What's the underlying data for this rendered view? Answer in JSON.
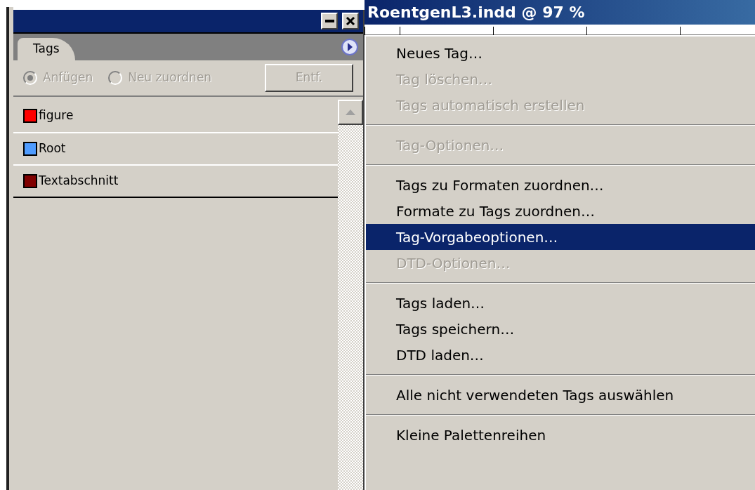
{
  "document_window": {
    "title": "RoentgenL3.indd @ 97 %"
  },
  "panel": {
    "tabs": [
      {
        "label": "Tags",
        "selected": true
      }
    ],
    "options": [
      {
        "label": "Anfügen",
        "selected": true,
        "disabled": true
      },
      {
        "label": "Neu zuordnen",
        "selected": false,
        "disabled": true
      }
    ],
    "delete_button": {
      "label": "Entf.",
      "disabled": true
    },
    "tags": [
      {
        "name": "figure",
        "color": "#ff0000"
      },
      {
        "name": "Root",
        "color": "#4f9cff"
      },
      {
        "name": "Textabschnitt",
        "color": "#800000"
      }
    ]
  },
  "menu": [
    {
      "kind": "item",
      "label": "Neues Tag…",
      "disabled": false,
      "selected": false
    },
    {
      "kind": "item",
      "label": "Tag löschen…",
      "disabled": true,
      "selected": false
    },
    {
      "kind": "item",
      "label": "Tags automatisch erstellen",
      "disabled": true,
      "selected": false
    },
    {
      "kind": "separator"
    },
    {
      "kind": "item",
      "label": "Tag-Optionen…",
      "disabled": true,
      "selected": false
    },
    {
      "kind": "separator"
    },
    {
      "kind": "item",
      "label": "Tags zu Formaten zuordnen…",
      "disabled": false,
      "selected": false
    },
    {
      "kind": "item",
      "label": "Formate zu Tags zuordnen…",
      "disabled": false,
      "selected": false
    },
    {
      "kind": "item",
      "label": "Tag-Vorgabeoptionen…",
      "disabled": false,
      "selected": true
    },
    {
      "kind": "item",
      "label": "DTD-Optionen…",
      "disabled": true,
      "selected": false
    },
    {
      "kind": "separator"
    },
    {
      "kind": "item",
      "label": "Tags laden…",
      "disabled": false,
      "selected": false
    },
    {
      "kind": "item",
      "label": "Tags speichern…",
      "disabled": false,
      "selected": false
    },
    {
      "kind": "item",
      "label": "DTD laden…",
      "disabled": false,
      "selected": false
    },
    {
      "kind": "separator"
    },
    {
      "kind": "item",
      "label": "Alle nicht verwendeten Tags auswählen",
      "disabled": false,
      "selected": false
    },
    {
      "kind": "separator"
    },
    {
      "kind": "item",
      "label": "Kleine Palettenreihen",
      "disabled": false,
      "selected": false
    }
  ]
}
